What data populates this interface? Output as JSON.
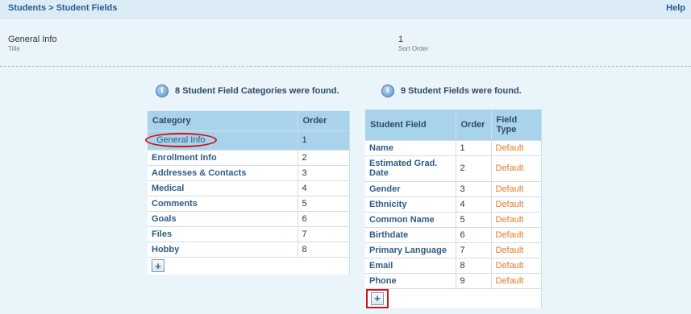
{
  "header": {
    "breadcrumb": "Students > Student Fields",
    "help_label": "Help"
  },
  "detail": {
    "title_value": "General Info",
    "title_label": "Title",
    "sort_order_value": "1",
    "sort_order_label": "Sort Order"
  },
  "categories": {
    "found_text": "8 Student Field Categories were found.",
    "col_category": "Category",
    "col_order": "Order",
    "rows": [
      {
        "name": "General Info",
        "order": "1"
      },
      {
        "name": "Enrollment Info",
        "order": "2"
      },
      {
        "name": "Addresses & Contacts",
        "order": "3"
      },
      {
        "name": "Medical",
        "order": "4"
      },
      {
        "name": "Comments",
        "order": "5"
      },
      {
        "name": "Goals",
        "order": "6"
      },
      {
        "name": "Files",
        "order": "7"
      },
      {
        "name": "Hobby",
        "order": "8"
      }
    ]
  },
  "fields": {
    "found_text": "9 Student Fields were found.",
    "col_field": "Student Field",
    "col_order": "Order",
    "col_type": "Field Type",
    "rows": [
      {
        "name": "Name",
        "order": "1",
        "type": "Default"
      },
      {
        "name": "Estimated Grad. Date",
        "order": "2",
        "type": "Default"
      },
      {
        "name": "Gender",
        "order": "3",
        "type": "Default"
      },
      {
        "name": "Ethnicity",
        "order": "4",
        "type": "Default"
      },
      {
        "name": "Common Name",
        "order": "5",
        "type": "Default"
      },
      {
        "name": "Birthdate",
        "order": "6",
        "type": "Default"
      },
      {
        "name": "Primary Language",
        "order": "7",
        "type": "Default"
      },
      {
        "name": "Email",
        "order": "8",
        "type": "Default"
      },
      {
        "name": "Phone",
        "order": "9",
        "type": "Default"
      }
    ]
  }
}
